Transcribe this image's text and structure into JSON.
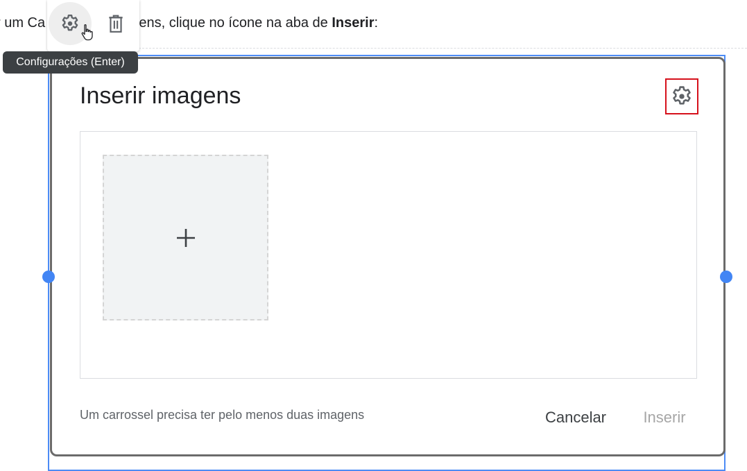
{
  "instruction": {
    "prefix": "r um Ca",
    "middle": "agens, clique no ícone na aba de ",
    "bold": "Inserir",
    "suffix": ":"
  },
  "toolbar": {
    "settings_icon": "gear-icon",
    "delete_icon": "trash-icon",
    "tooltip": "Configurações (Enter)"
  },
  "dialog": {
    "title": "Inserir imagens",
    "settings_icon": "gear-icon",
    "add_icon": "plus-icon",
    "footer_note": "Um carrossel precisa ter pelo menos duas imagens",
    "cancel_label": "Cancelar",
    "insert_label": "Inserir",
    "insert_enabled": false
  },
  "colors": {
    "selection": "#4c8bf5",
    "highlight_box": "#d6101b",
    "tooltip_bg": "#3c4043",
    "disabled_text": "#a6a6a6"
  }
}
